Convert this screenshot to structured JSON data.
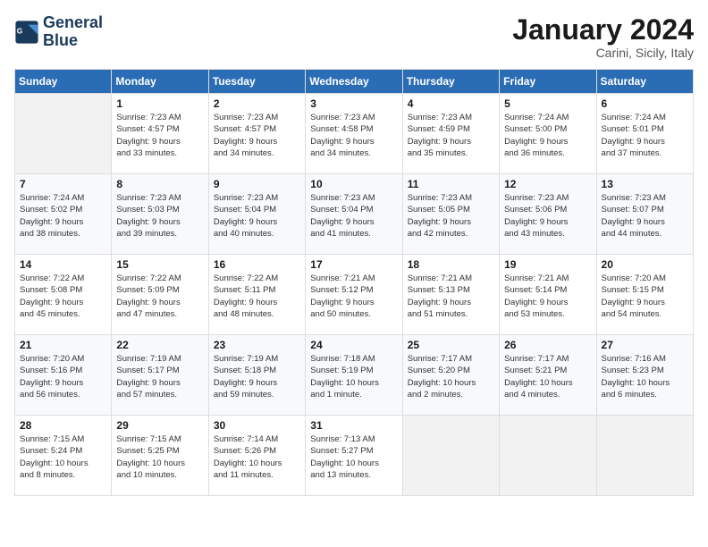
{
  "header": {
    "logo_line1": "General",
    "logo_line2": "Blue",
    "month_title": "January 2024",
    "subtitle": "Carini, Sicily, Italy"
  },
  "weekdays": [
    "Sunday",
    "Monday",
    "Tuesday",
    "Wednesday",
    "Thursday",
    "Friday",
    "Saturday"
  ],
  "weeks": [
    [
      {
        "day": "",
        "info": ""
      },
      {
        "day": "1",
        "info": "Sunrise: 7:23 AM\nSunset: 4:57 PM\nDaylight: 9 hours\nand 33 minutes."
      },
      {
        "day": "2",
        "info": "Sunrise: 7:23 AM\nSunset: 4:57 PM\nDaylight: 9 hours\nand 34 minutes."
      },
      {
        "day": "3",
        "info": "Sunrise: 7:23 AM\nSunset: 4:58 PM\nDaylight: 9 hours\nand 34 minutes."
      },
      {
        "day": "4",
        "info": "Sunrise: 7:23 AM\nSunset: 4:59 PM\nDaylight: 9 hours\nand 35 minutes."
      },
      {
        "day": "5",
        "info": "Sunrise: 7:24 AM\nSunset: 5:00 PM\nDaylight: 9 hours\nand 36 minutes."
      },
      {
        "day": "6",
        "info": "Sunrise: 7:24 AM\nSunset: 5:01 PM\nDaylight: 9 hours\nand 37 minutes."
      }
    ],
    [
      {
        "day": "7",
        "info": "Sunrise: 7:24 AM\nSunset: 5:02 PM\nDaylight: 9 hours\nand 38 minutes."
      },
      {
        "day": "8",
        "info": "Sunrise: 7:23 AM\nSunset: 5:03 PM\nDaylight: 9 hours\nand 39 minutes."
      },
      {
        "day": "9",
        "info": "Sunrise: 7:23 AM\nSunset: 5:04 PM\nDaylight: 9 hours\nand 40 minutes."
      },
      {
        "day": "10",
        "info": "Sunrise: 7:23 AM\nSunset: 5:04 PM\nDaylight: 9 hours\nand 41 minutes."
      },
      {
        "day": "11",
        "info": "Sunrise: 7:23 AM\nSunset: 5:05 PM\nDaylight: 9 hours\nand 42 minutes."
      },
      {
        "day": "12",
        "info": "Sunrise: 7:23 AM\nSunset: 5:06 PM\nDaylight: 9 hours\nand 43 minutes."
      },
      {
        "day": "13",
        "info": "Sunrise: 7:23 AM\nSunset: 5:07 PM\nDaylight: 9 hours\nand 44 minutes."
      }
    ],
    [
      {
        "day": "14",
        "info": "Sunrise: 7:22 AM\nSunset: 5:08 PM\nDaylight: 9 hours\nand 45 minutes."
      },
      {
        "day": "15",
        "info": "Sunrise: 7:22 AM\nSunset: 5:09 PM\nDaylight: 9 hours\nand 47 minutes."
      },
      {
        "day": "16",
        "info": "Sunrise: 7:22 AM\nSunset: 5:11 PM\nDaylight: 9 hours\nand 48 minutes."
      },
      {
        "day": "17",
        "info": "Sunrise: 7:21 AM\nSunset: 5:12 PM\nDaylight: 9 hours\nand 50 minutes."
      },
      {
        "day": "18",
        "info": "Sunrise: 7:21 AM\nSunset: 5:13 PM\nDaylight: 9 hours\nand 51 minutes."
      },
      {
        "day": "19",
        "info": "Sunrise: 7:21 AM\nSunset: 5:14 PM\nDaylight: 9 hours\nand 53 minutes."
      },
      {
        "day": "20",
        "info": "Sunrise: 7:20 AM\nSunset: 5:15 PM\nDaylight: 9 hours\nand 54 minutes."
      }
    ],
    [
      {
        "day": "21",
        "info": "Sunrise: 7:20 AM\nSunset: 5:16 PM\nDaylight: 9 hours\nand 56 minutes."
      },
      {
        "day": "22",
        "info": "Sunrise: 7:19 AM\nSunset: 5:17 PM\nDaylight: 9 hours\nand 57 minutes."
      },
      {
        "day": "23",
        "info": "Sunrise: 7:19 AM\nSunset: 5:18 PM\nDaylight: 9 hours\nand 59 minutes."
      },
      {
        "day": "24",
        "info": "Sunrise: 7:18 AM\nSunset: 5:19 PM\nDaylight: 10 hours\nand 1 minute."
      },
      {
        "day": "25",
        "info": "Sunrise: 7:17 AM\nSunset: 5:20 PM\nDaylight: 10 hours\nand 2 minutes."
      },
      {
        "day": "26",
        "info": "Sunrise: 7:17 AM\nSunset: 5:21 PM\nDaylight: 10 hours\nand 4 minutes."
      },
      {
        "day": "27",
        "info": "Sunrise: 7:16 AM\nSunset: 5:23 PM\nDaylight: 10 hours\nand 6 minutes."
      }
    ],
    [
      {
        "day": "28",
        "info": "Sunrise: 7:15 AM\nSunset: 5:24 PM\nDaylight: 10 hours\nand 8 minutes."
      },
      {
        "day": "29",
        "info": "Sunrise: 7:15 AM\nSunset: 5:25 PM\nDaylight: 10 hours\nand 10 minutes."
      },
      {
        "day": "30",
        "info": "Sunrise: 7:14 AM\nSunset: 5:26 PM\nDaylight: 10 hours\nand 11 minutes."
      },
      {
        "day": "31",
        "info": "Sunrise: 7:13 AM\nSunset: 5:27 PM\nDaylight: 10 hours\nand 13 minutes."
      },
      {
        "day": "",
        "info": ""
      },
      {
        "day": "",
        "info": ""
      },
      {
        "day": "",
        "info": ""
      }
    ]
  ]
}
